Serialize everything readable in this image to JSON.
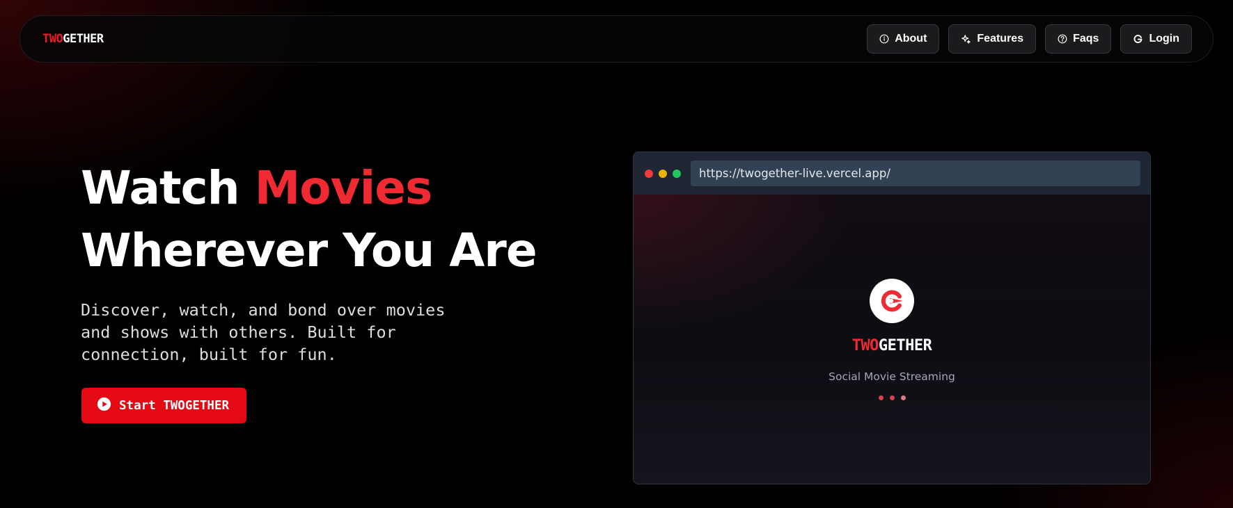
{
  "brand": {
    "logo_part1": "TWO",
    "logo_part2": "GETHER",
    "accent_color": "#ef1b25"
  },
  "nav": {
    "items": [
      {
        "label": "About",
        "icon": "info-icon"
      },
      {
        "label": "Features",
        "icon": "sparkles-icon"
      },
      {
        "label": "Faqs",
        "icon": "help-circle-icon"
      },
      {
        "label": "Login",
        "icon": "google-icon"
      }
    ]
  },
  "hero": {
    "title_line1_plain": "Watch ",
    "title_line1_accent": "Movies",
    "title_line2": "Wherever You Are",
    "description": "Discover, watch, and bond over movies and shows with others. Built for connection, built for fun.",
    "cta_label": "Start TWOGETHER",
    "cta_icon": "play-circle-icon"
  },
  "preview": {
    "url": "https://twogether-live.vercel.app/",
    "app_name_part1": "TWO",
    "app_name_part2": "GETHER",
    "tagline": "Social Movie Streaming",
    "app_icon": "twogether-logo-icon"
  }
}
